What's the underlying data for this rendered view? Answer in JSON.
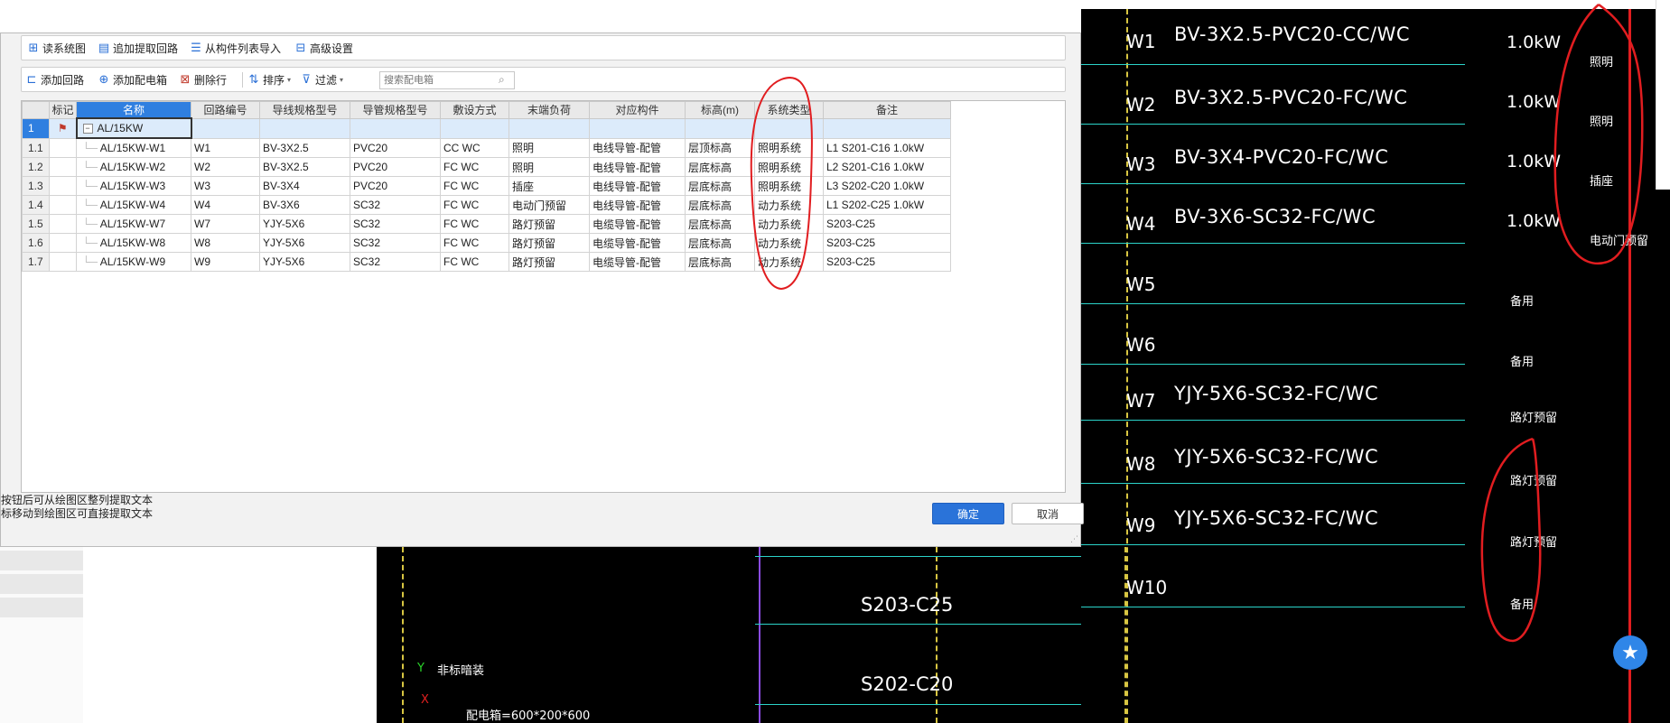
{
  "toolbar1": {
    "read_system": "读系统图",
    "append_extract": "追加提取回路",
    "import_from_list": "从构件列表导入",
    "advanced": "高级设置"
  },
  "toolbar2": {
    "add_circuit": "添加回路",
    "add_box": "添加配电箱",
    "delete_row": "删除行",
    "sort": "排序",
    "filter": "过滤",
    "search_placeholder": "搜索配电箱"
  },
  "table": {
    "headers": [
      "标记",
      "名称",
      "回路编号",
      "导线规格型号",
      "导管规格型号",
      "敷设方式",
      "末端负荷",
      "对应构件",
      "标高(m)",
      "系统类型",
      "备注"
    ],
    "group": {
      "num": "1",
      "name": "AL/15KW"
    },
    "rows": [
      {
        "num": "1.1",
        "name": "AL/15KW-W1",
        "circuit": "W1",
        "wire": "BV-3X2.5",
        "conduit": "PVC20",
        "laying": "CC WC",
        "load": "照明",
        "component": "电线导管-配管",
        "elevation": "层顶标高",
        "system": "照明系统",
        "remark": "L1 S201-C16 1.0kW"
      },
      {
        "num": "1.2",
        "name": "AL/15KW-W2",
        "circuit": "W2",
        "wire": "BV-3X2.5",
        "conduit": "PVC20",
        "laying": "FC WC",
        "load": "照明",
        "component": "电线导管-配管",
        "elevation": "层底标高",
        "system": "照明系统",
        "remark": "L2 S201-C16 1.0kW"
      },
      {
        "num": "1.3",
        "name": "AL/15KW-W3",
        "circuit": "W3",
        "wire": "BV-3X4",
        "conduit": "PVC20",
        "laying": "FC WC",
        "load": "插座",
        "component": "电线导管-配管",
        "elevation": "层底标高",
        "system": "照明系统",
        "remark": "L3 S202-C20 1.0kW"
      },
      {
        "num": "1.4",
        "name": "AL/15KW-W4",
        "circuit": "W4",
        "wire": "BV-3X6",
        "conduit": "SC32",
        "laying": "FC WC",
        "load": "电动门预留",
        "component": "电线导管-配管",
        "elevation": "层底标高",
        "system": "动力系统",
        "remark": "L1 S202-C25 1.0kW"
      },
      {
        "num": "1.5",
        "name": "AL/15KW-W7",
        "circuit": "W7",
        "wire": "YJY-5X6",
        "conduit": "SC32",
        "laying": "FC WC",
        "load": "路灯预留",
        "component": "电缆导管-配管",
        "elevation": "层底标高",
        "system": "动力系统",
        "remark": "S203-C25"
      },
      {
        "num": "1.6",
        "name": "AL/15KW-W8",
        "circuit": "W8",
        "wire": "YJY-5X6",
        "conduit": "SC32",
        "laying": "FC WC",
        "load": "路灯预留",
        "component": "电缆导管-配管",
        "elevation": "层底标高",
        "system": "动力系统",
        "remark": "S203-C25"
      },
      {
        "num": "1.7",
        "name": "AL/15KW-W9",
        "circuit": "W9",
        "wire": "YJY-5X6",
        "conduit": "SC32",
        "laying": "FC WC",
        "load": "路灯预留",
        "component": "电缆导管-配管",
        "elevation": "层底标高",
        "system": "动力系统",
        "remark": "S203-C25"
      }
    ]
  },
  "hints": {
    "line1": "按钮后可从绘图区整列提取文本",
    "line2": "标移动到绘图区可直接提取文本"
  },
  "buttons": {
    "ok": "确定",
    "cancel": "取消"
  },
  "cad": {
    "circuits": [
      {
        "w": "W1",
        "spec": "BV-3X2.5-PVC20-CC/WC",
        "kw": "1.0kW",
        "load": "照明"
      },
      {
        "w": "W2",
        "spec": "BV-3X2.5-PVC20-FC/WC",
        "kw": "1.0kW",
        "load": "照明"
      },
      {
        "w": "W3",
        "spec": "BV-3X4-PVC20-FC/WC",
        "kw": "1.0kW",
        "load": "插座"
      },
      {
        "w": "W4",
        "spec": "BV-3X6-SC32-FC/WC",
        "kw": "1.0kW",
        "load": "电动门预留"
      },
      {
        "w": "W5",
        "spec": "",
        "kw": "",
        "load": "备用"
      },
      {
        "w": "W6",
        "spec": "",
        "kw": "",
        "load": "备用"
      },
      {
        "w": "W7",
        "spec": "YJY-5X6-SC32-FC/WC",
        "kw": "",
        "load": "路灯预留"
      },
      {
        "w": "W8",
        "spec": "YJY-5X6-SC32-FC/WC",
        "kw": "",
        "load": "路灯预留"
      },
      {
        "w": "W9",
        "spec": "YJY-5X6-SC32-FC/WC",
        "kw": "",
        "load": "路灯预留"
      },
      {
        "w": "W10",
        "spec": "",
        "kw": "",
        "load": "备用"
      }
    ],
    "breaker1": "S203-C25",
    "breaker2": "S202-C20",
    "mount_note": "非标暗装",
    "dimension_note": "配电箱=600*200*600",
    "axis_x": "X",
    "axis_y": "Y"
  },
  "colors": {
    "accent": "#2a73d9",
    "cad_bg": "#000000",
    "annotation": "#e11d20",
    "wire": "#2bd3c9"
  }
}
